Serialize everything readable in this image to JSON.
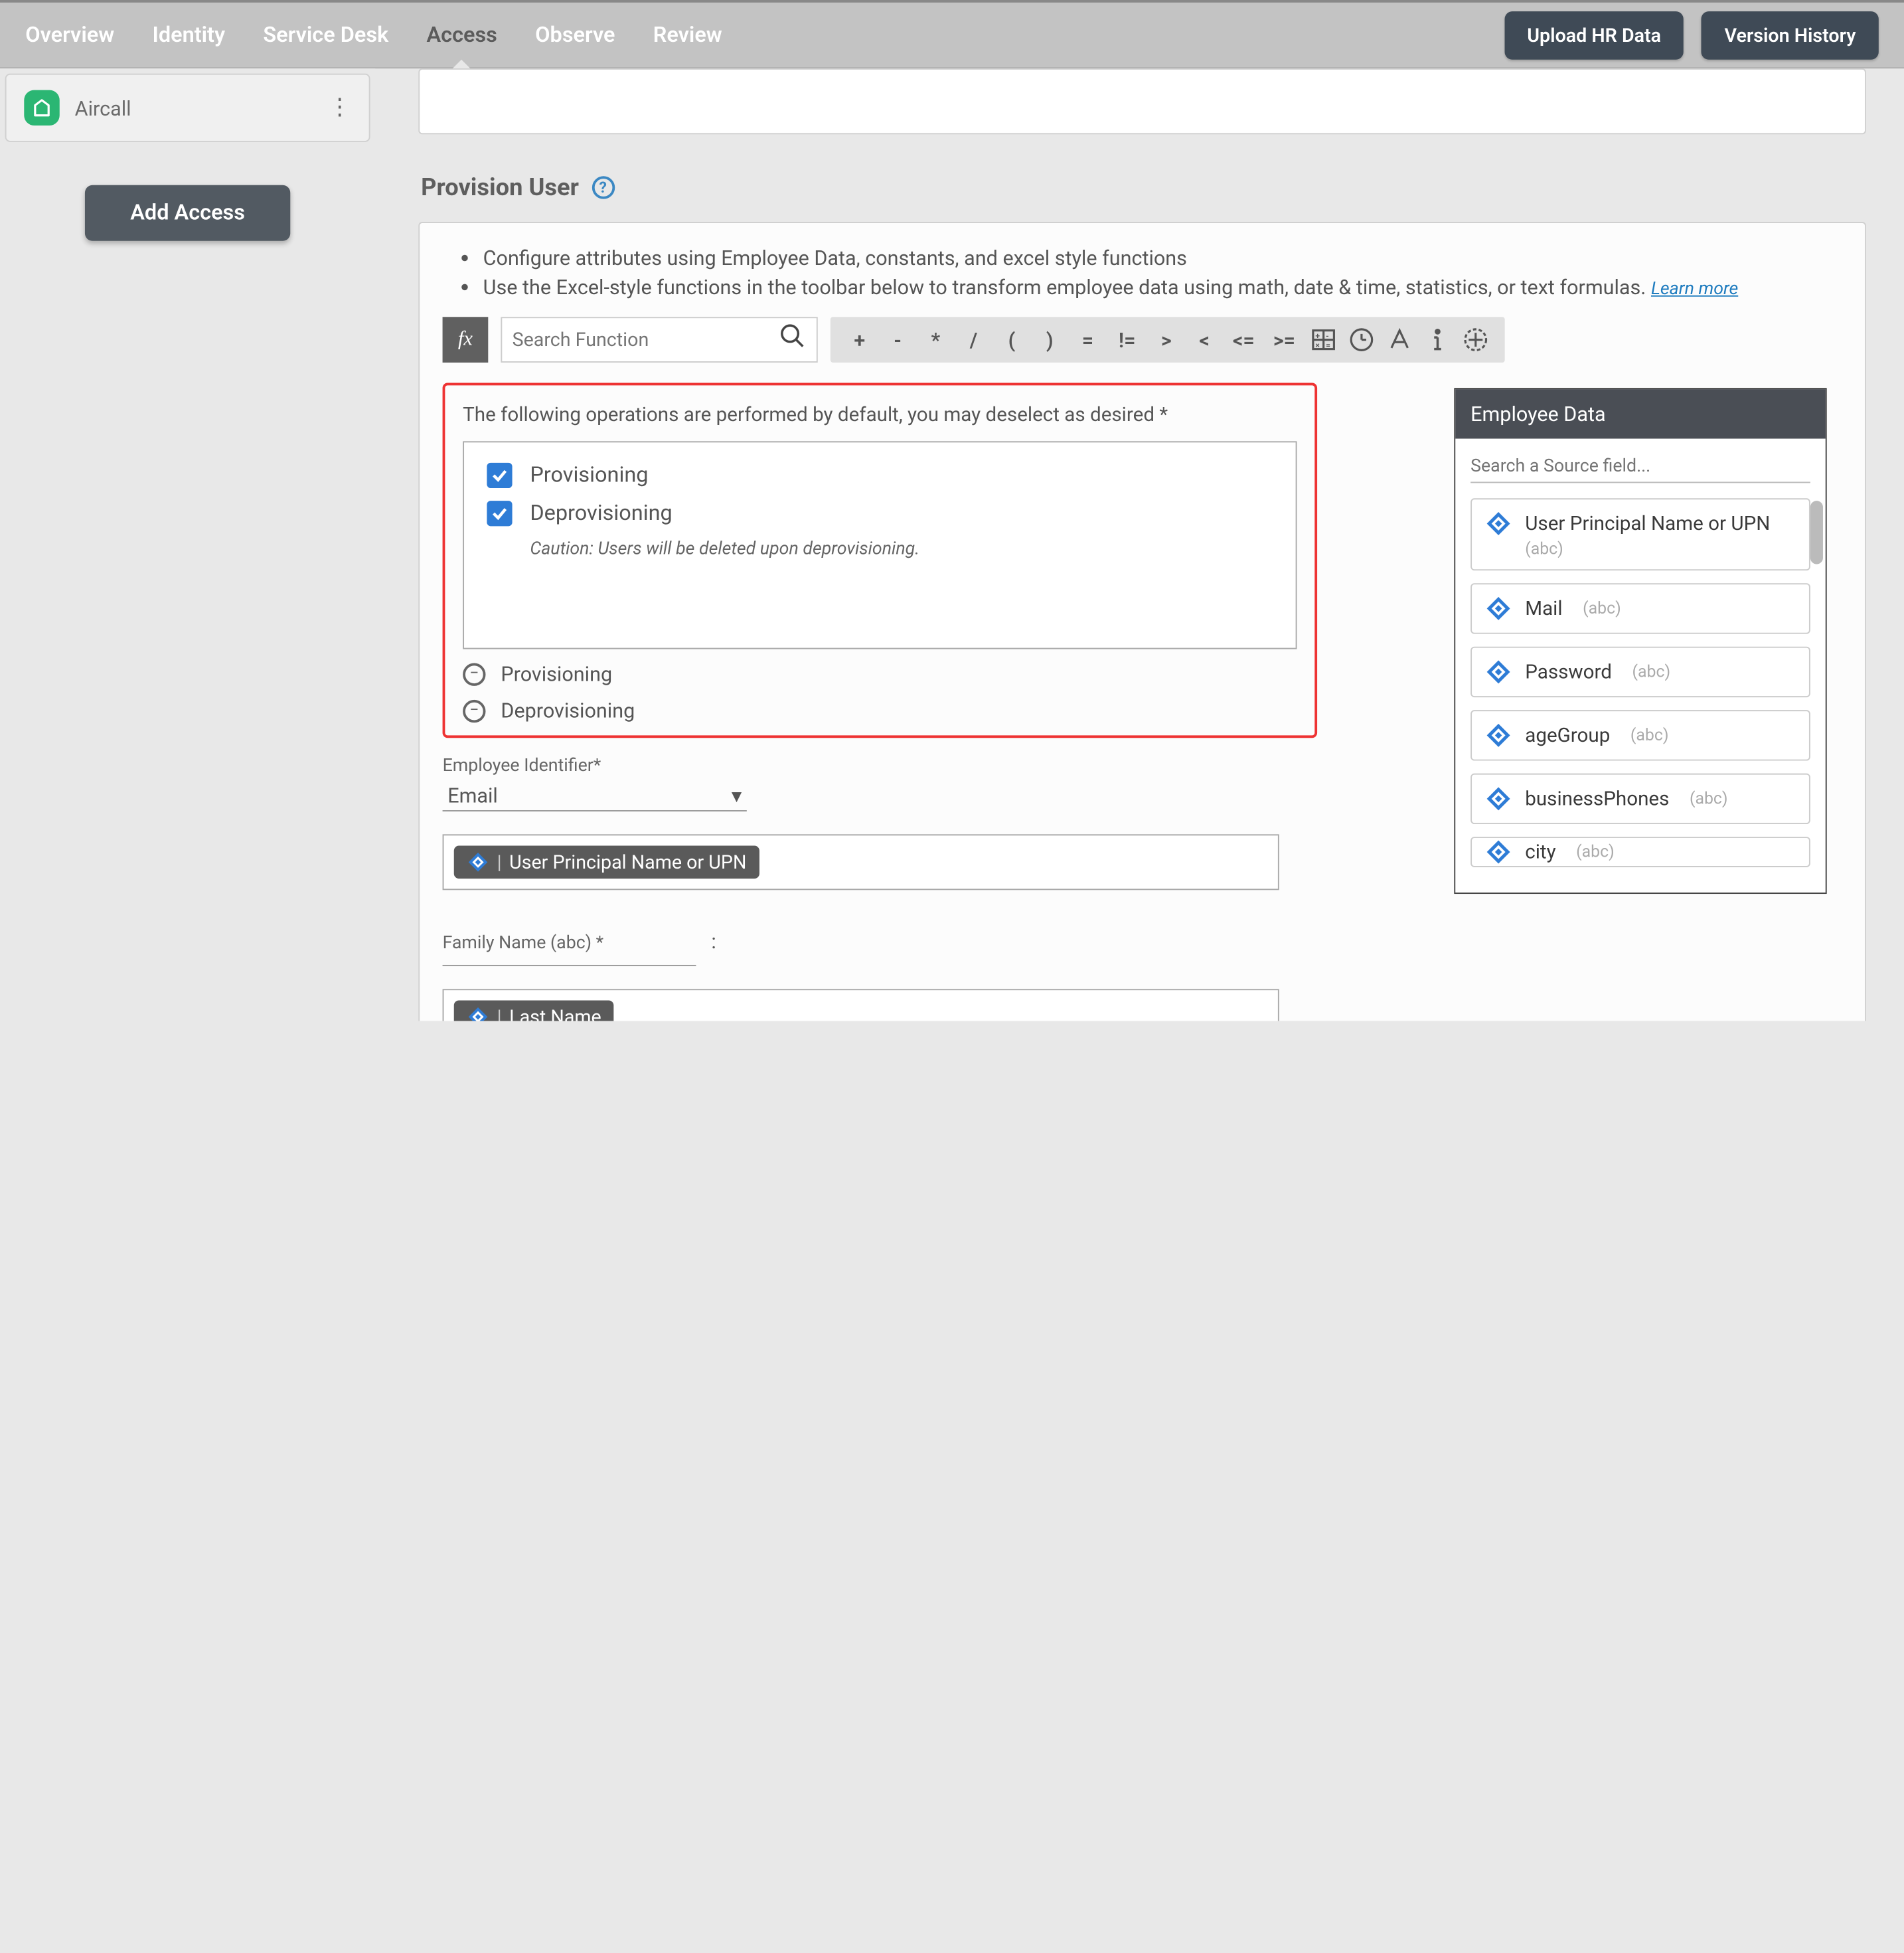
{
  "nav": {
    "tabs": [
      "Overview",
      "Identity",
      "Service Desk",
      "Access",
      "Observe",
      "Review"
    ],
    "active": "Access",
    "upload": "Upload HR Data",
    "version": "Version History"
  },
  "sidebar": {
    "app_name": "Aircall",
    "add_access": "Add Access"
  },
  "section": {
    "title": "Provision User",
    "bullet1": "Configure attributes using Employee Data, constants, and excel style functions",
    "bullet2": "Use the Excel-style functions in the toolbar below to transform employee data using math, date & time, statistics, or text formulas.",
    "learn_more": "Learn more"
  },
  "formula": {
    "fx": "fx",
    "search_placeholder": "Search Function",
    "ops": [
      "+",
      "-",
      "*",
      "/",
      "(",
      ")",
      "=",
      "!=",
      ">",
      "<",
      "<=",
      ">="
    ]
  },
  "operations": {
    "note": "The following operations are performed by default, you may deselect as desired *",
    "items": [
      {
        "label": "Provisioning",
        "checked": true
      },
      {
        "label": "Deprovisioning",
        "checked": true
      }
    ],
    "caution": "Caution: Users will be deleted upon deprovisioning.",
    "toggles": [
      "Provisioning",
      "Deprovisioning"
    ]
  },
  "fields": {
    "emp_id_label": "Employee Identifier*",
    "emp_id_value": "Email",
    "upn_token": "User Principal Name or UPN",
    "family_label": "Family Name (abc) *",
    "colon": ":",
    "lastname_token": "Last Name"
  },
  "empdata": {
    "title": "Employee Data",
    "search_placeholder": "Search a Source field...",
    "fields": [
      {
        "name": "User Principal Name or UPN",
        "type": "(abc)",
        "twoline": true
      },
      {
        "name": "Mail",
        "type": "(abc)"
      },
      {
        "name": "Password",
        "type": "(abc)"
      },
      {
        "name": "ageGroup",
        "type": "(abc)"
      },
      {
        "name": "businessPhones",
        "type": "(abc)"
      },
      {
        "name": "city",
        "type": "(abc)"
      }
    ]
  }
}
